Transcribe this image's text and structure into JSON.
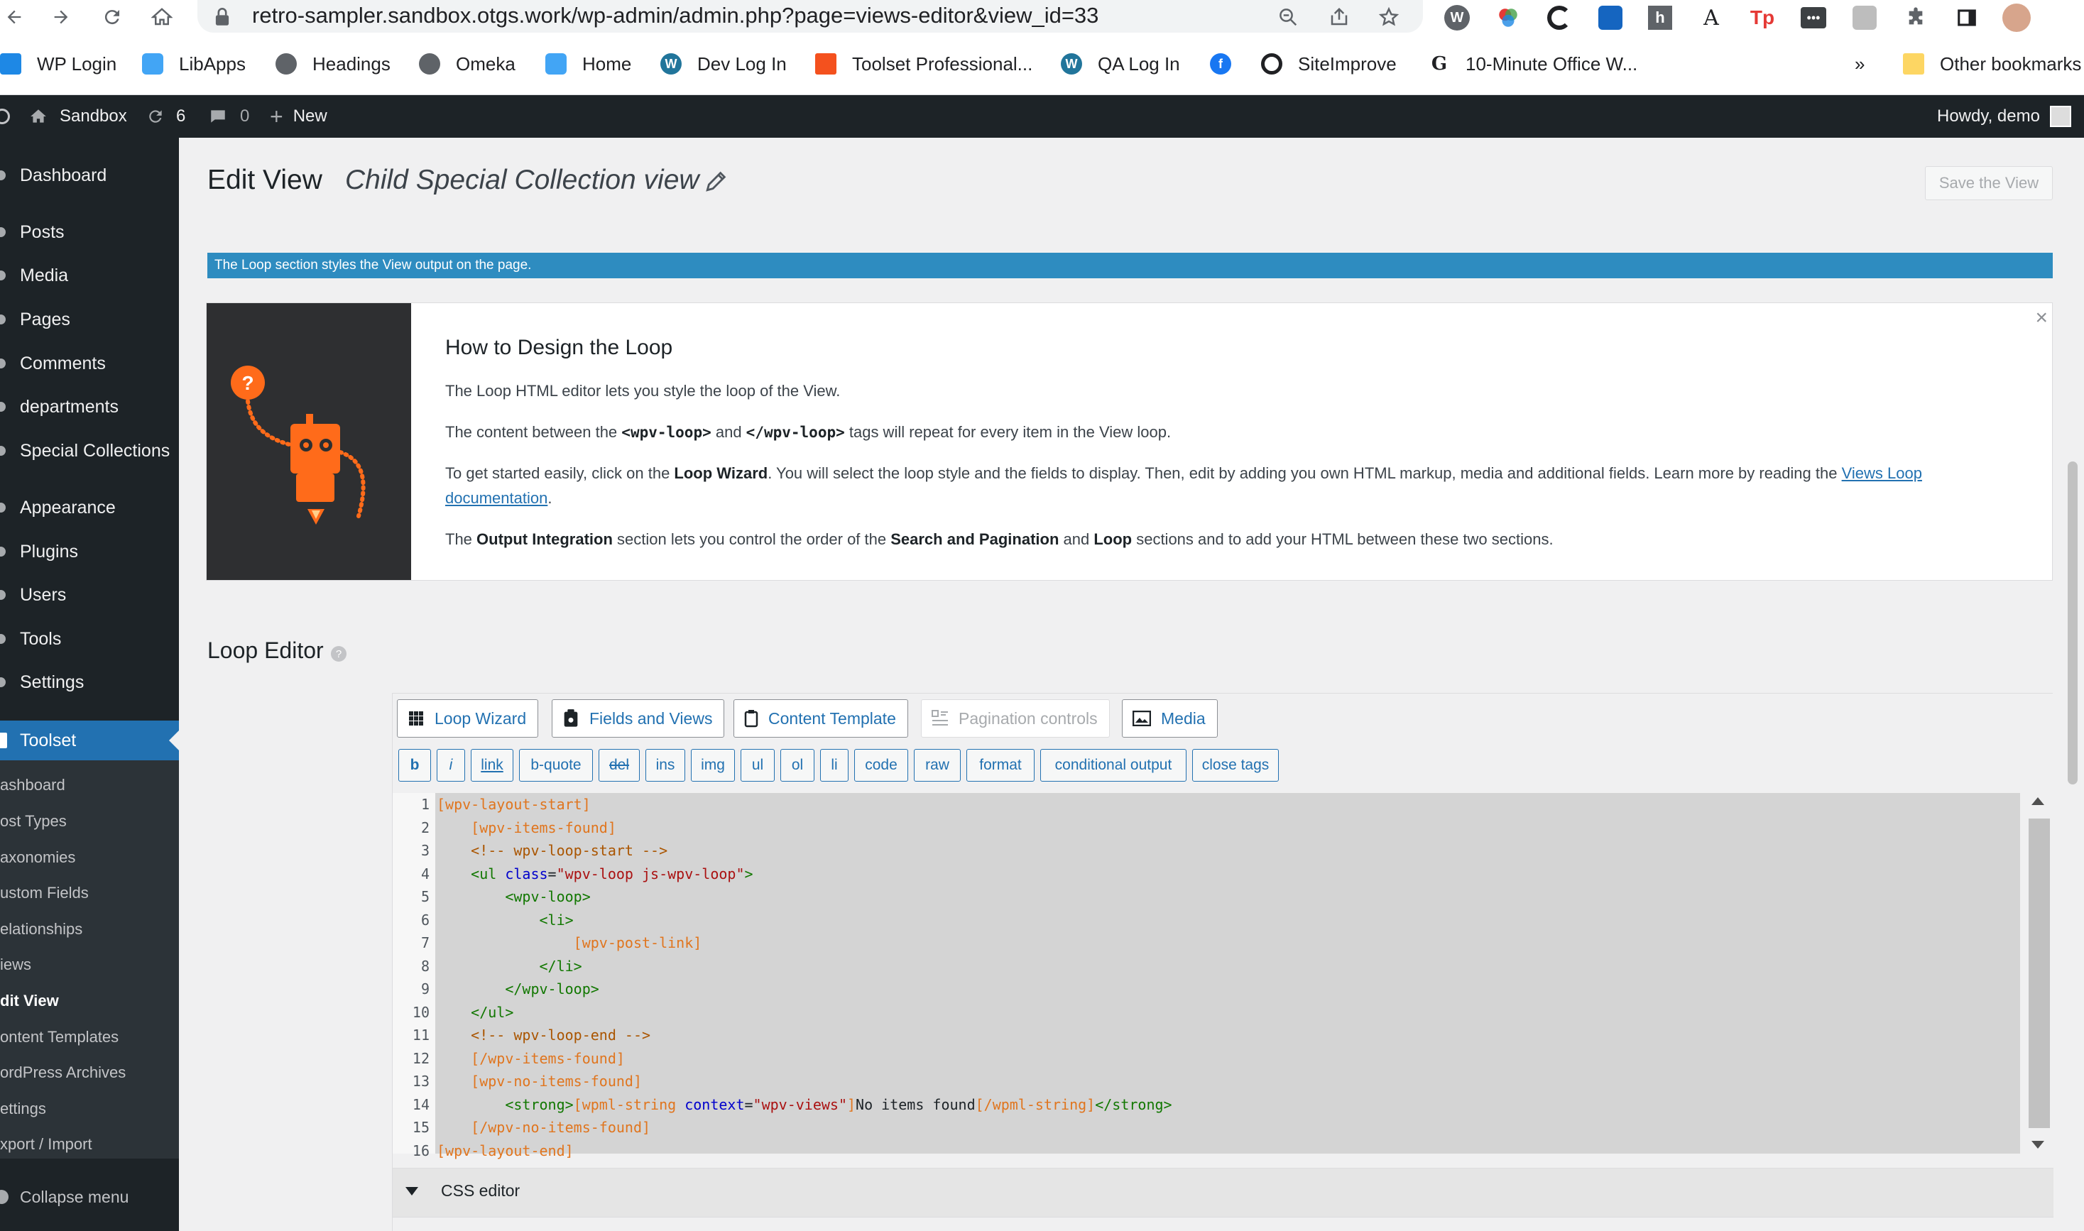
{
  "browser": {
    "url": "retro-sampler.sandbox.otgs.work/wp-admin/admin.php?page=views-editor&view_id=33",
    "bookmarks": [
      "WP Login",
      "LibApps",
      "Headings",
      "Omeka",
      "Home",
      "Dev Log In",
      "Toolset Professional...",
      "QA Log In",
      "",
      "SiteImprove",
      "10-Minute Office W..."
    ],
    "overflow": "»",
    "other_bookmarks": "Other bookmarks"
  },
  "adminbar": {
    "site": "Sandbox",
    "updates": "6",
    "comments": "0",
    "new": "New",
    "howdy": "Howdy, demo"
  },
  "sidebar": {
    "items": [
      "Dashboard",
      "Posts",
      "Media",
      "Pages",
      "Comments",
      "departments",
      "Special Collections",
      "Appearance",
      "Plugins",
      "Users",
      "Tools",
      "Settings"
    ],
    "active": "Toolset",
    "submenu": [
      "ashboard",
      "ost Types",
      "axonomies",
      "ustom Fields",
      "elationships",
      "iews",
      "dit View",
      "ontent Templates",
      "ordPress Archives",
      "ettings",
      "xport / Import"
    ],
    "collapse": "Collapse menu"
  },
  "page": {
    "title": "Edit View",
    "view_name": "Child Special Collection view",
    "save_button": "Save the View",
    "notice": "The Loop section styles the View output on the page."
  },
  "help": {
    "title": "How to Design the Loop",
    "p1": "The Loop HTML editor lets you style the loop of the View.",
    "p2_a": "The content between the ",
    "p2_b": "<wpv-loop>",
    "p2_c": " and ",
    "p2_d": "</wpv-loop>",
    "p2_e": " tags will repeat for every item in the View loop.",
    "p3_a": "To get started easily, click on the ",
    "p3_b": "Loop Wizard",
    "p3_c": ". You will select the loop style and the fields to display. Then, edit by adding you own HTML markup, media and additional fields. Learn more by reading the ",
    "p3_link1": "Views Loop",
    "p3_link2": "documentation",
    "p3_end": ".",
    "p4_a": "The ",
    "p4_b": "Output Integration",
    "p4_c": " section lets you control the order of the ",
    "p4_d": "Search and Pagination",
    "p4_e": " and ",
    "p4_f": "Loop",
    "p4_g": " sections and to add your HTML between these two sections."
  },
  "loop_editor": {
    "heading": "Loop Editor",
    "toolbar": [
      "Loop Wizard",
      "Fields and Views",
      "Content Template",
      "Pagination controls",
      "Media"
    ],
    "quicktags": [
      "b",
      "i",
      "link",
      "b-quote",
      "del",
      "ins",
      "img",
      "ul",
      "ol",
      "li",
      "code",
      "raw",
      "format",
      "conditional output",
      "close tags"
    ],
    "line_numbers": [
      "1",
      "2",
      "3",
      "4",
      "5",
      "6",
      "7",
      "8",
      "9",
      "10",
      "11",
      "12",
      "13",
      "14",
      "15",
      "16"
    ],
    "code": {
      "l1": "[wpv-layout-start]",
      "l2": "    [wpv-items-found]",
      "l3": "    <!-- wpv-loop-start -->",
      "l4_a": "    <ul ",
      "l4_b": "class",
      "l4_c": "=",
      "l4_d": "\"wpv-loop js-wpv-loop\"",
      "l4_e": ">",
      "l5": "        <wpv-loop>",
      "l6": "            <li>",
      "l7": "                [wpv-post-link]",
      "l8": "            </li>",
      "l9": "        </wpv-loop>",
      "l10": "    </ul>",
      "l11": "    <!-- wpv-loop-end -->",
      "l12": "    [/wpv-items-found]",
      "l13": "    [wpv-no-items-found]",
      "l14_a": "        <strong>",
      "l14_b": "[wpml-string ",
      "l14_c": "context",
      "l14_d": "=",
      "l14_e": "\"wpv-views\"",
      "l14_f": "]",
      "l14_g": "No items found",
      "l14_h": "[/wpml-string]",
      "l14_i": "</strong>",
      "l15": "    [/wpv-no-items-found]",
      "l16": "[wpv-layout-end]"
    },
    "css_editor": "CSS editor"
  },
  "colors": {
    "admin_bar": "#1d2327",
    "accent": "#2271b1",
    "notice": "#2e8cc0",
    "robot": "#ff6b1a"
  }
}
